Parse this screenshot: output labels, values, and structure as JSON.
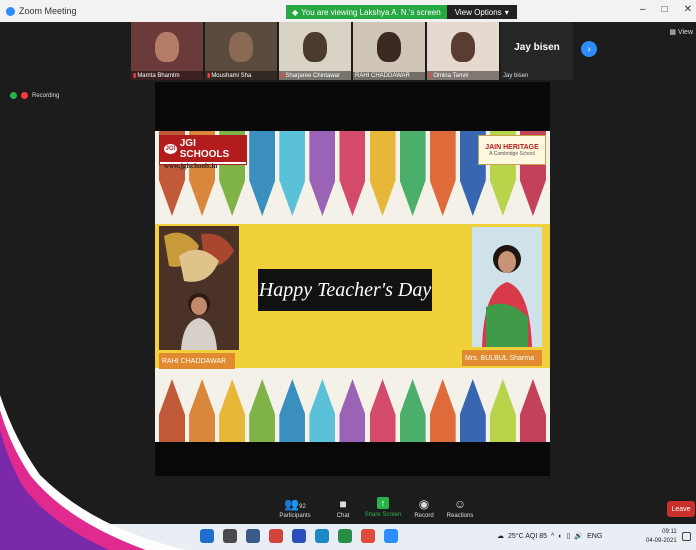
{
  "window": {
    "title": "Zoom Meeting",
    "share_message": "You are viewing Lakshya A. N.'s screen",
    "view_options": "View Options",
    "view_label": "View"
  },
  "participants": [
    {
      "name": "Mamta Bhamtm"
    },
    {
      "name": "Moushami Sha"
    },
    {
      "name": "Sharjaree Chintawar"
    },
    {
      "name": "RAHI CHADDAWAR"
    },
    {
      "name": "Omina Tanvir"
    }
  ],
  "name_tile": {
    "big": "Jay bisen",
    "small": "Jay bisen"
  },
  "recording": {
    "label": "Recording"
  },
  "slide": {
    "left_logo": "JGI SCHOOLS",
    "left_logo_badge": "JGI",
    "left_url": "www.jgischools.in",
    "right_logo": "JAIN HERITAGE",
    "right_logo_sub": "A Cambridge School",
    "greeting": "Happy Teacher's Day",
    "student_name": "RAHI CHADDAWAR",
    "teacher_name": "Mrs. BULBUL Sharma"
  },
  "toolbar": {
    "participants_label": "Participants",
    "participants_count": "92",
    "chat_label": "Chat",
    "share_label": "Share Screen",
    "record_label": "Record",
    "reactions_label": "Reactions",
    "leave_label": "Leave"
  },
  "taskbar": {
    "weather": "25°C AQI 85",
    "lang": "ENG",
    "time": "09:11",
    "date": "04-09-2021"
  },
  "colors": {
    "zoom_blue": "#2d8cff",
    "share_green": "#26a843",
    "leave_red": "#c9302c",
    "slide_band": "#f1d13a",
    "name_tag": "#e28a2f"
  },
  "icons": {
    "participants": "people-icon",
    "chat": "chat-bubble-icon",
    "share": "share-arrow-icon",
    "record": "record-icon",
    "reactions": "smiley-plus-icon"
  }
}
